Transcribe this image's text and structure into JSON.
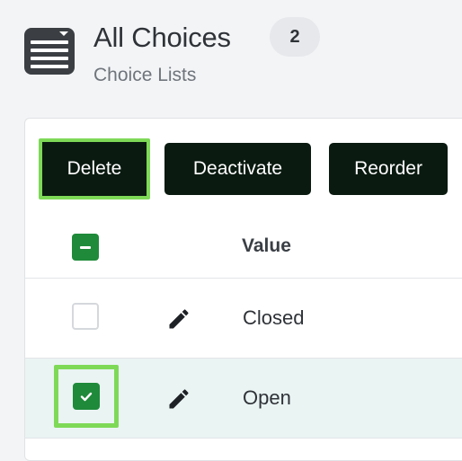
{
  "header": {
    "icon": "list-box-icon",
    "title": "All Choices",
    "count": "2",
    "subtitle": "Choice Lists"
  },
  "toolbar": {
    "delete_label": "Delete",
    "deactivate_label": "Deactivate",
    "reorder_label": "Reorder"
  },
  "table": {
    "columns": [
      "Value"
    ],
    "select_all_state": "indeterminate",
    "rows": [
      {
        "value": "Closed",
        "checked": false,
        "edit_icon": "pencil-icon"
      },
      {
        "value": "Open",
        "checked": true,
        "edit_icon": "pencil-icon"
      }
    ]
  },
  "colors": {
    "accent_green": "#1f8a3a",
    "highlight": "#7ed957",
    "button_dark": "#0a1a10",
    "selected_row": "#eaf4f3"
  }
}
